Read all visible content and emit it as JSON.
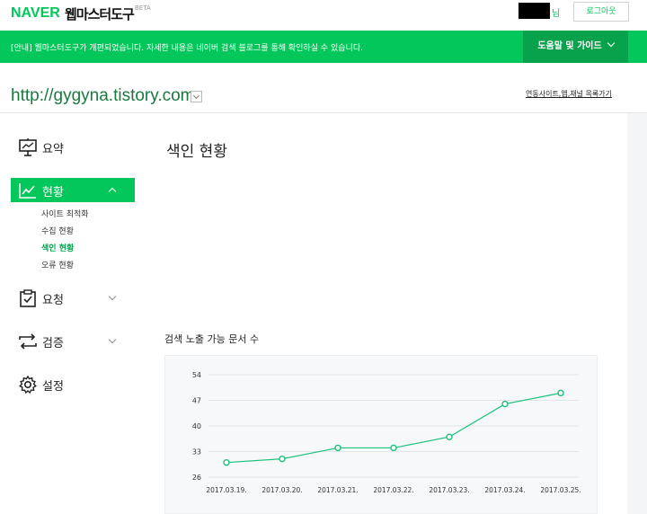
{
  "header": {
    "brand": "NAVER",
    "service_name": "웹마스터도구",
    "beta": "BETA",
    "user_suffix": "님",
    "logout_label": "로그아웃"
  },
  "notice": {
    "text": "[안내] 웹마스터도구가 개편되었습니다. 자세한 내용은 네이버 검색 블로그를 통해 확인하실 수 있습니다.",
    "help_label": "도움말 및 가이드"
  },
  "site": {
    "url": "http://gygyna.tistory.com",
    "link_label": "연동사이트,앱,채널 목록가기"
  },
  "sidebar": {
    "items": [
      {
        "label": "요약",
        "icon": "presentation-board-icon"
      },
      {
        "label": "현황",
        "icon": "trend-chart-icon"
      },
      {
        "label": "요청",
        "icon": "clipboard-icon"
      },
      {
        "label": "검증",
        "icon": "sync-arrows-icon"
      },
      {
        "label": "설정",
        "icon": "gear-icon"
      }
    ],
    "sub_items": [
      {
        "label": "사이트 최적화"
      },
      {
        "label": "수집 현황"
      },
      {
        "label": "색인 현황"
      },
      {
        "label": "오류 현황"
      }
    ]
  },
  "main": {
    "title": "색인 현황",
    "chart_title": "검색 노출 가능 문서 수"
  },
  "colors": {
    "accent": "#03c75a",
    "accent_dark": "#08a14c",
    "line": "#19c27a"
  },
  "chart_data": {
    "type": "line",
    "title": "검색 노출 가능 문서 수",
    "categories": [
      "2017.03.19.",
      "2017.03.20.",
      "2017.03.21.",
      "2017.03.22.",
      "2017.03.23.",
      "2017.03.24.",
      "2017.03.25."
    ],
    "series": [
      {
        "values": [
          30,
          31,
          34,
          34,
          37,
          46,
          49
        ]
      }
    ],
    "y_ticks": [
      26,
      33,
      40,
      47,
      54
    ],
    "ylim": [
      26,
      54
    ],
    "grid": true
  }
}
